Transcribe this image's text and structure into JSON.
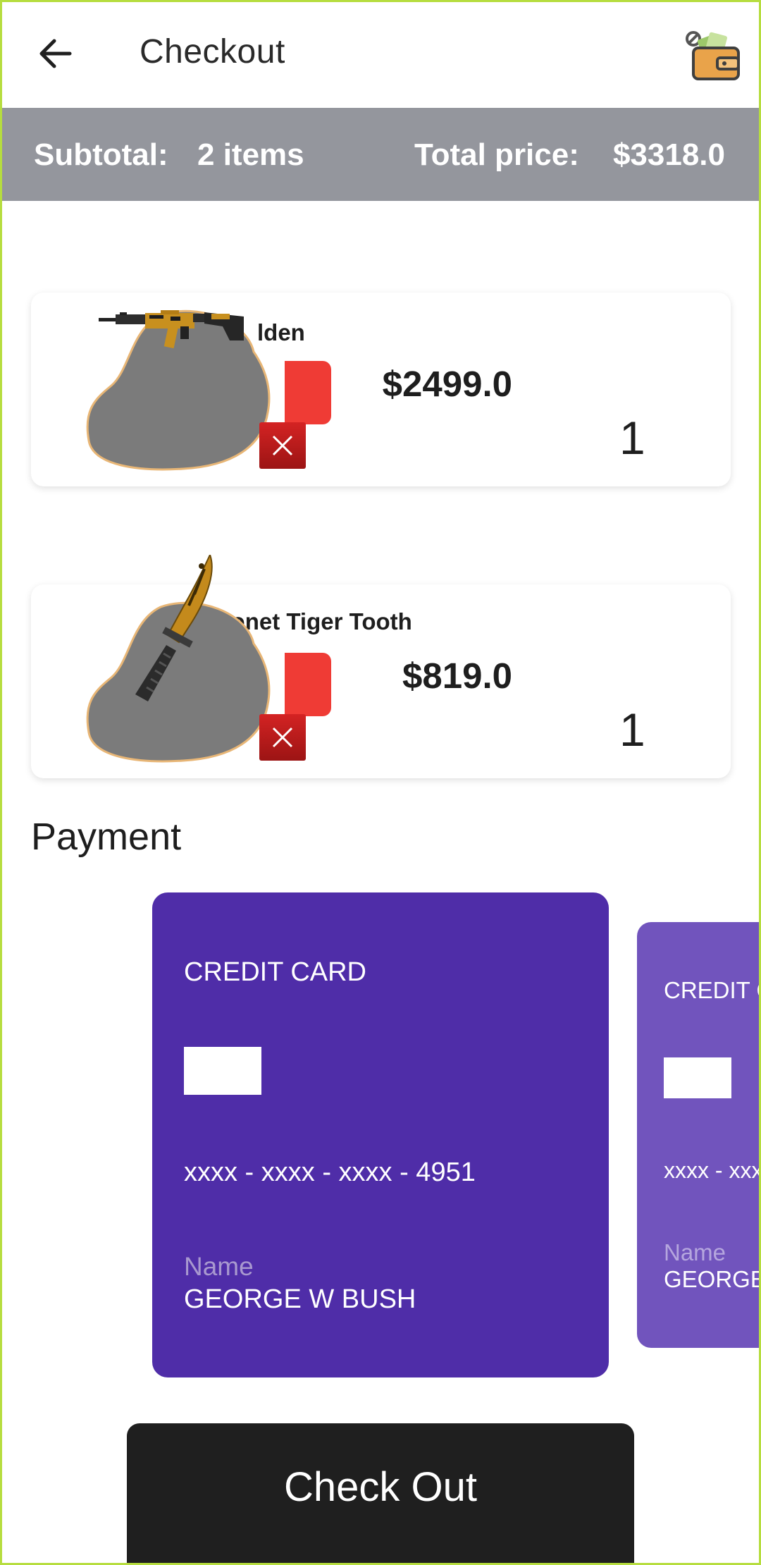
{
  "appbar": {
    "title": "Checkout",
    "back_icon": "arrow-back-icon",
    "wallet_icon": "wallet-icon"
  },
  "summary": {
    "subtotal_label": "Subtotal:",
    "subtotal_value": "2 items",
    "total_label": "Total price:",
    "total_value": "$3318.0"
  },
  "cart": {
    "items": [
      {
        "name": "M4A1-S | Golden",
        "visible_name_fragment": "lden",
        "price": "$2499.0",
        "quantity": "1",
        "image_icon": "rifle-icon"
      },
      {
        "name": "M9 Bayonet Tiger Tooth",
        "visible_name_fragment": "M9 Bayonet Tiger Tooth",
        "price": "$819.0",
        "quantity": "1",
        "image_icon": "knife-icon"
      }
    ]
  },
  "payment": {
    "title": "Payment",
    "cards": [
      {
        "type": "CREDIT CARD",
        "number": "xxxx - xxxx - xxxx - 4951",
        "name_label": "Name",
        "holder": "GEORGE W BUSH"
      },
      {
        "type": "CREDIT CARD",
        "number": "xxxx - xxxx - xxxx",
        "name_label": "Name",
        "holder": "GEORGE"
      }
    ]
  },
  "checkout_button": "Check Out",
  "colors": {
    "summary_bar": "#94969d",
    "card_primary": "#4f2da8",
    "card_secondary": "#7154bd",
    "remove_button": "#c01c1c",
    "quantity_strip": "#ef3b35",
    "checkout_button": "#1f1f1f",
    "frame": "#b6dd3f"
  }
}
